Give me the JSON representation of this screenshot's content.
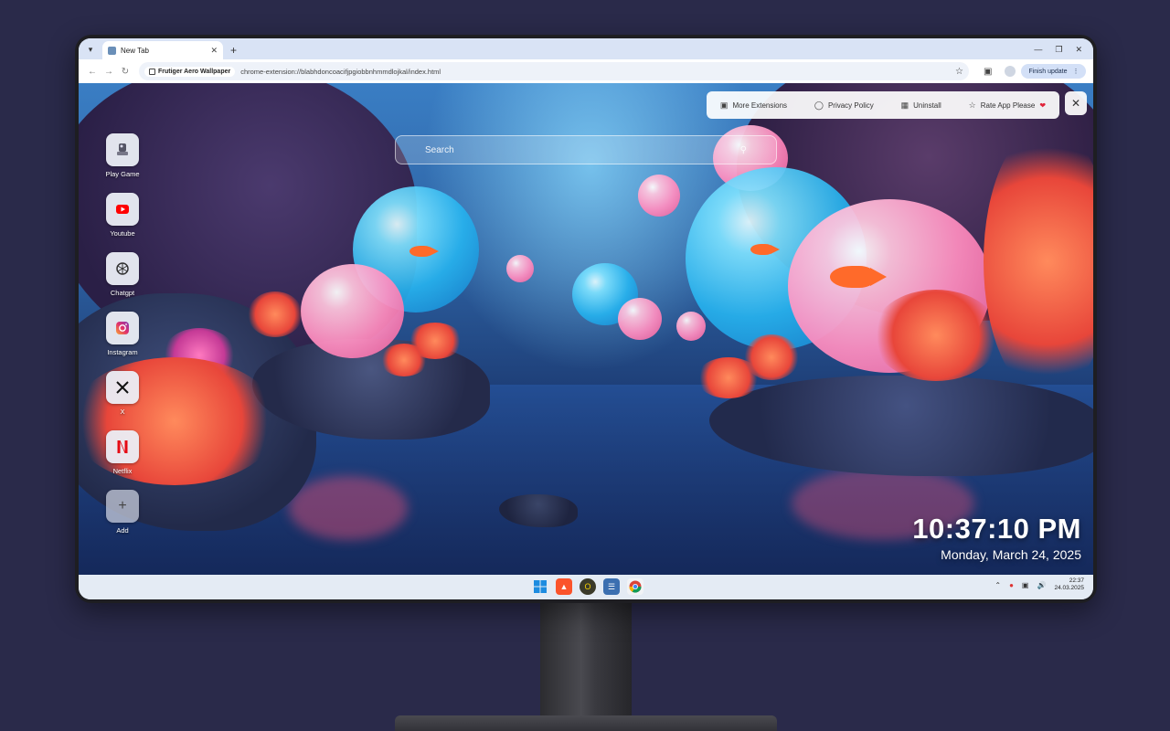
{
  "browser": {
    "tab_title": "New Tab",
    "extension_chip": "Frutiger Aero Wallpaper",
    "url": "chrome-extension://blabhdoncoacifjpgiobbnhmmdlojkal/index.html",
    "finish_update": "Finish update"
  },
  "search": {
    "placeholder": "Search"
  },
  "top_menu": {
    "more_extensions": "More Extensions",
    "privacy_policy": "Privacy Policy",
    "uninstall": "Uninstall",
    "rate_app": "Rate App Please"
  },
  "shortcuts": [
    {
      "label": "Play Game",
      "icon": "game-icon"
    },
    {
      "label": "Youtube",
      "icon": "youtube-icon"
    },
    {
      "label": "Chatgpt",
      "icon": "chatgpt-icon"
    },
    {
      "label": "Instagram",
      "icon": "instagram-icon"
    },
    {
      "label": "X",
      "icon": "x-icon"
    },
    {
      "label": "Netflix",
      "icon": "netflix-icon"
    },
    {
      "label": "Add",
      "icon": "plus-icon"
    }
  ],
  "clock": {
    "time": "10:37:10 PM",
    "date": "Monday, March 24, 2025"
  },
  "taskbar": {
    "time": "22:37",
    "date": "24.03.2025"
  },
  "colors": {
    "background": "#2a2a4a",
    "heart": "#e0243a",
    "youtube": "#ff0000",
    "netflix": "#e50914"
  }
}
